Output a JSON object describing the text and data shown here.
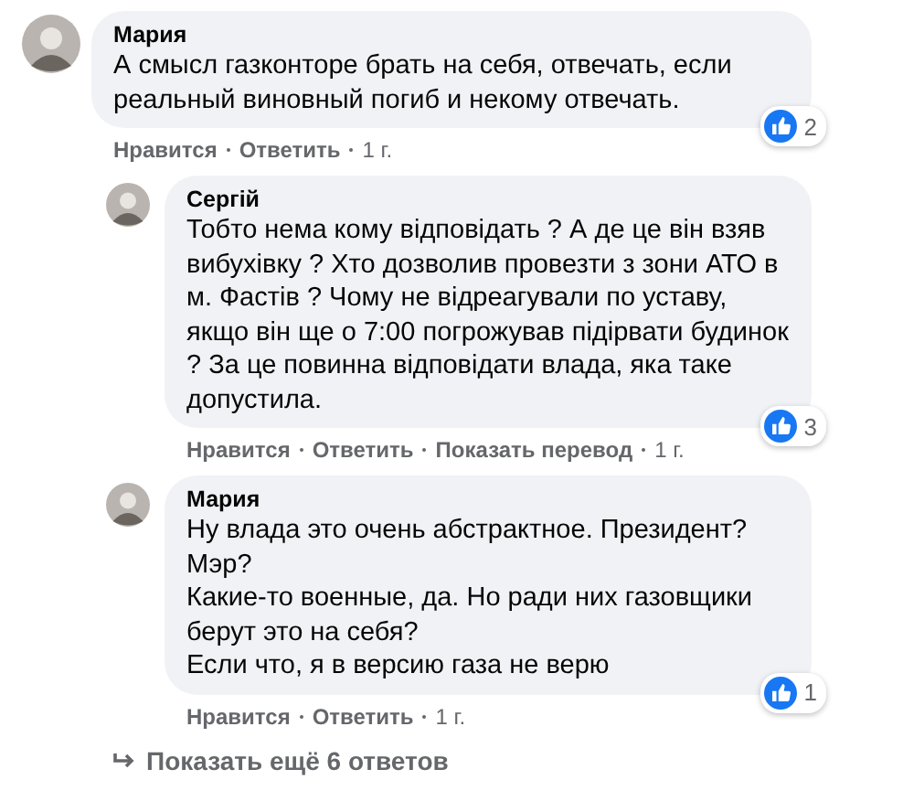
{
  "comments": [
    {
      "author": "Мария",
      "text": "А смысл газконторе брать на себя, отвечать, если\nреальный виновный погиб и некому отвечать.",
      "reactions": "2",
      "actions": [
        "Нравится",
        "Ответить"
      ],
      "time": "1 г.",
      "children": [
        {
          "author": "Сергій",
          "text": "Тобто нема кому відповідать ? А де це він взяв\nвибухівку ? Хто дозволив провезти з зони АТО в\nм. Фастів ? Чому не відреагували по уставу,\nякщо він ще о 7:00 погрожував підірвати будинок\n? За це повинна відповідати влада, яка таке\nдопустила.",
          "reactions": "3",
          "actions": [
            "Нравится",
            "Ответить",
            "Показать перевод"
          ],
          "time": "1 г."
        },
        {
          "author": "Мария",
          "text": "Ну влада это очень абстрактное. Президент?\nМэр?\nКакие-то военные, да. Но ради них газовщики\nберут это на себя?\nЕсли что, я в версию газа не верю",
          "reactions": "1",
          "actions": [
            "Нравится",
            "Ответить"
          ],
          "time": "1 г."
        }
      ],
      "more_replies": "Показать ещё 6 ответов"
    }
  ]
}
